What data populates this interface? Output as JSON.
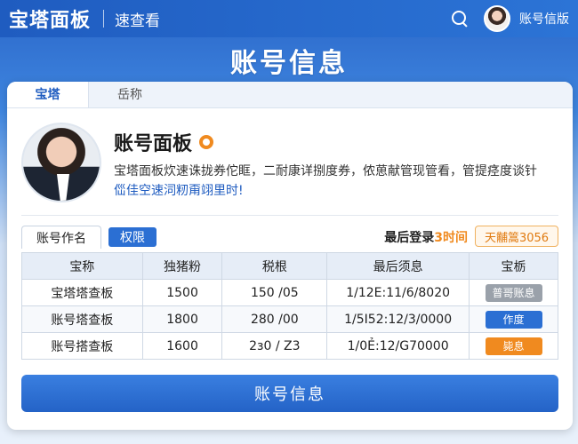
{
  "header": {
    "brand": "宝塔面板",
    "quick_link": "速查看",
    "username": "账号信版"
  },
  "page_title": "账号信息",
  "tabs": [
    {
      "label": "宝塔"
    },
    {
      "label": "岳称"
    }
  ],
  "profile": {
    "name": "账号面板",
    "desc_line1": "宝塔面板炊速诛拢券佗眶，二耐康详捌度券，侬葸献管现管看，管提痉度谈针",
    "desc_line2": "㑎佳空速泀籾甭翊里时!"
  },
  "subtabs": {
    "active": "账号作名",
    "button": "权限"
  },
  "last_login": {
    "label": "最后登录",
    "time": "3时间",
    "chip": "天黼篙3056"
  },
  "table": {
    "headers": [
      "宝称",
      "独猪粉",
      "税根",
      "最后须息",
      "宝栃"
    ],
    "rows": [
      {
        "name": "宝塔塔查板",
        "num": "1500",
        "ratio": "150 /05",
        "date": "1/12E:11/6/8020",
        "status": "普哥账息",
        "status_color": "#9aa1aa"
      },
      {
        "name": "账号塔查板",
        "num": "1800",
        "ratio": "280 /00",
        "date": "1/5I52:12/3/0000",
        "status": "作度",
        "status_color": "#2b6fd3"
      },
      {
        "name": "账号搭查板",
        "num": "1600",
        "ratio": "2ɜ0 / Z3",
        "date": "1/0Ẻ:12/G70000",
        "status": "毙息",
        "status_color": "#f08a1f"
      }
    ]
  },
  "primary_button": "账号信息"
}
